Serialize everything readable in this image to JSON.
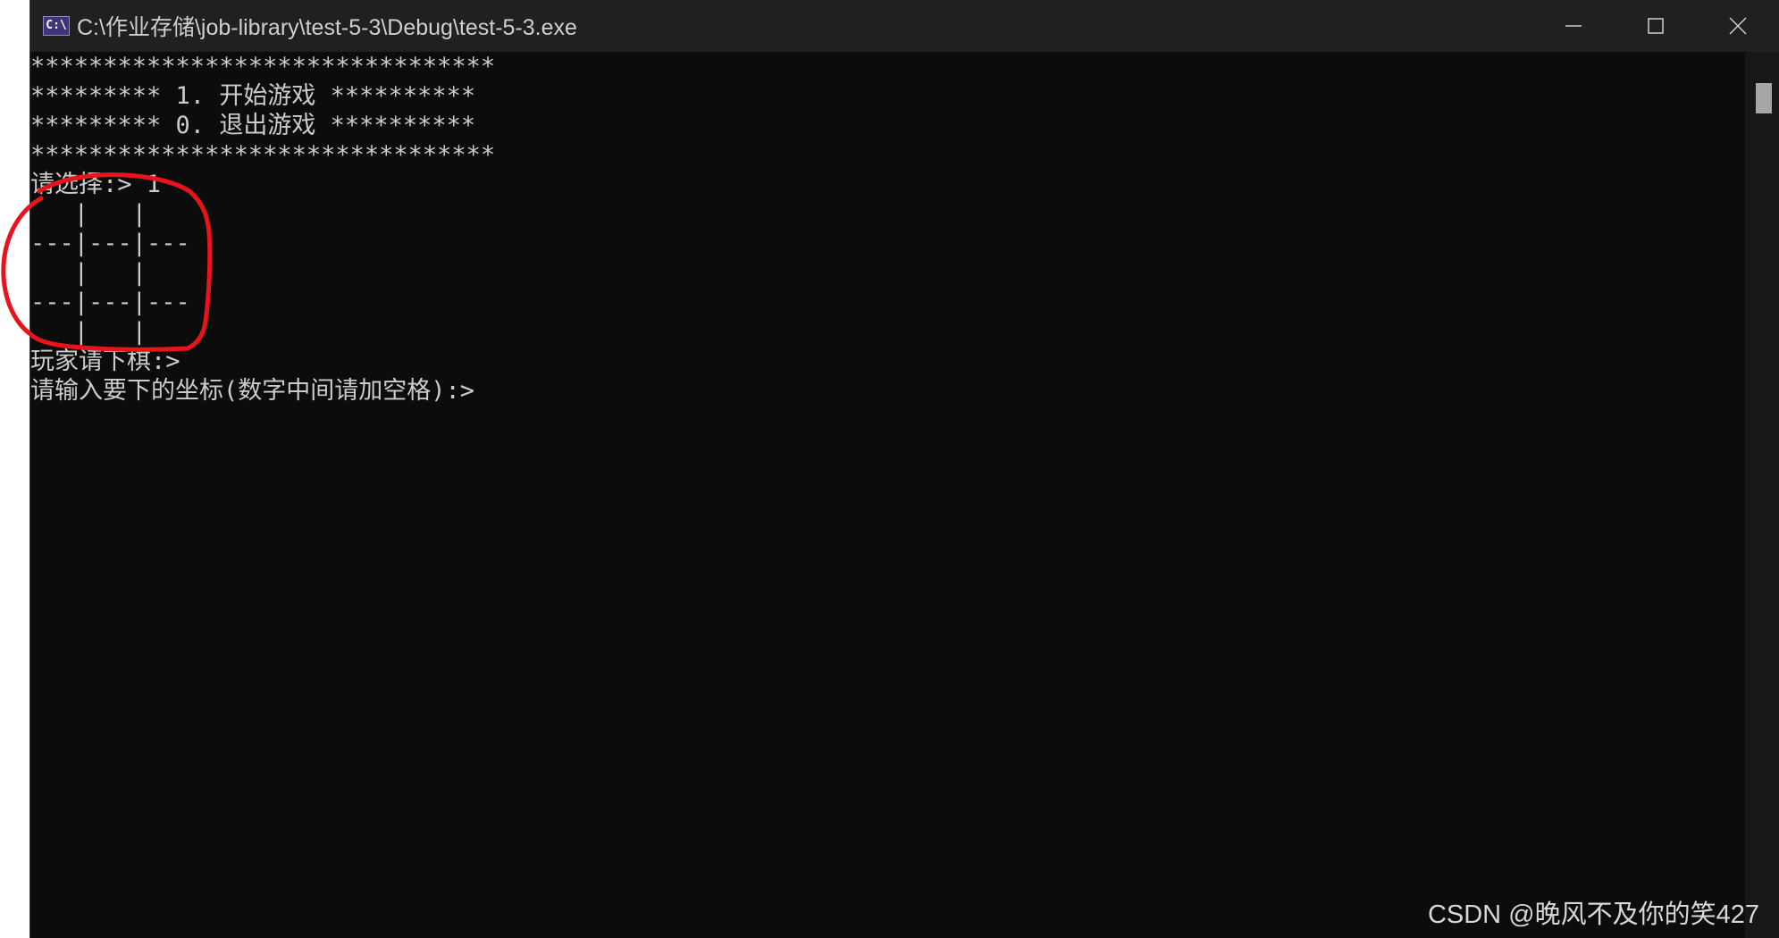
{
  "window": {
    "title": "C:\\作业存储\\job-library\\test-5-3\\Debug\\test-5-3.exe",
    "icon": "console-app-icon",
    "controls": {
      "minimize_icon": "minimize-icon",
      "maximize_icon": "maximize-icon",
      "close_icon": "close-icon"
    }
  },
  "console": {
    "lines": [
      "********************************",
      "********* 1. 开始游戏 **********",
      "********* 0. 退出游戏 **********",
      "********************************",
      "请选择:> 1",
      "   |   |   ",
      "---|---|---",
      "   |   |   ",
      "---|---|---",
      "   |   |   ",
      "玩家请下棋:>",
      "请输入要下的坐标(数字中间请加空格):>"
    ]
  },
  "annotation": {
    "color": "#e8141c"
  },
  "watermark": {
    "text": "CSDN @晚风不及你的笑427"
  },
  "colors": {
    "console_bg": "#0c0c0c",
    "console_text": "#cccccc",
    "titlebar_bg": "#202020"
  }
}
